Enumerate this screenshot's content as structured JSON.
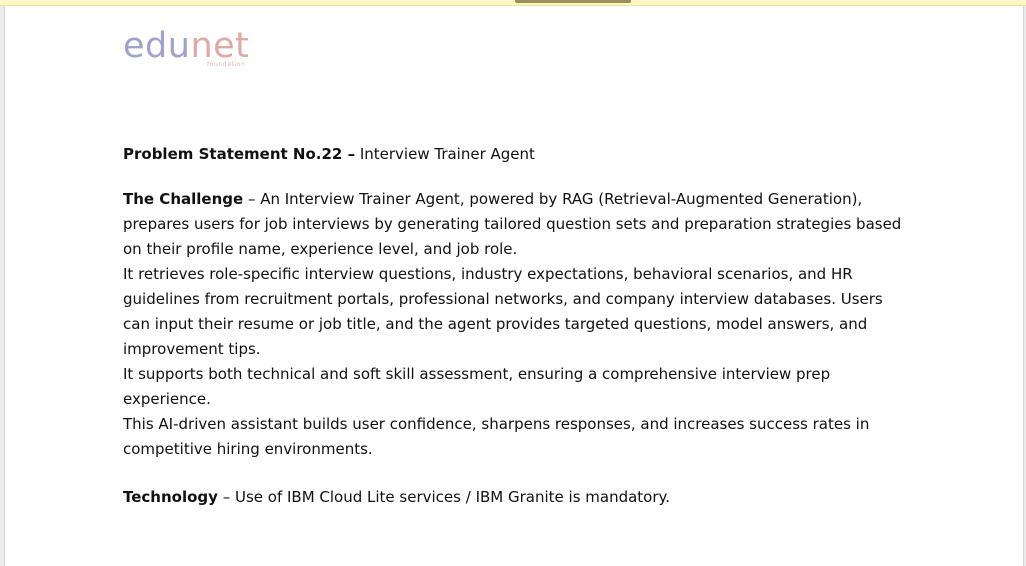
{
  "logo": {
    "part1": "edu",
    "part2": "net",
    "subtext": "foundation"
  },
  "title": {
    "bold": "Problem Statement No.22 –",
    "rest": " Interview Trainer Agent"
  },
  "challenge": {
    "bold": "The Challenge",
    "intro": " – An Interview Trainer Agent, powered by RAG (Retrieval-Augmented Generation), prepares users for job interviews by generating tailored question sets and preparation strategies based on their profile name, experience level, and job role.",
    "para2": " It retrieves role-specific interview questions, industry expectations, behavioral scenarios, and HR guidelines from recruitment portals, professional networks, and company interview databases.  Users can input their resume or job title, and the agent provides targeted questions, model answers, and improvement tips.",
    "para3": " It supports both technical and soft skill assessment, ensuring a comprehensive interview prep experience.",
    "para4": " This AI-driven assistant builds user confidence, sharpens responses, and increases success rates in competitive hiring environments."
  },
  "technology": {
    "bold": "Technology",
    "rest": " – Use of IBM Cloud Lite services / IBM Granite is mandatory."
  }
}
